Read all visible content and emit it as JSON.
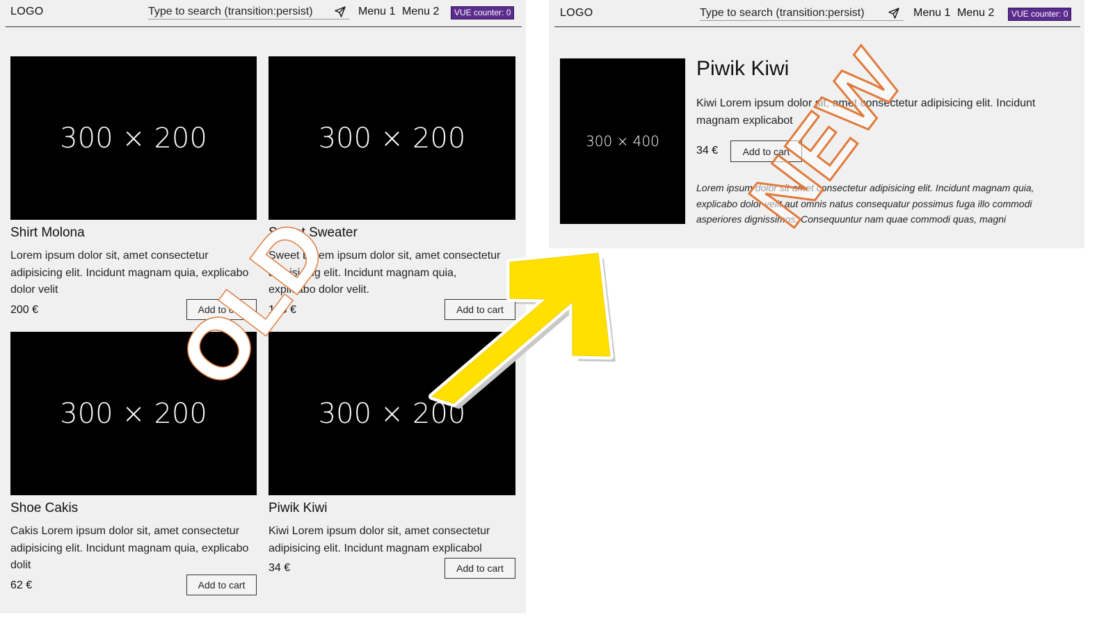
{
  "header": {
    "logo": "LOGO",
    "search_text": "Type to search (transition:persist)",
    "menu_1": "Menu 1",
    "menu_2": "Menu 2",
    "counter": "VUE counter: 0"
  },
  "old_page": {
    "products": [
      {
        "image_label": "300 × 200",
        "name": "Shirt Molona",
        "description": "Lorem ipsum dolor sit, amet consectetur adipisicing elit. Incidunt magnam quia, explicabo dolor velit",
        "price": "200 €",
        "button": "Add to cart"
      },
      {
        "image_label": "300 × 200",
        "name": "Sweet Sweater",
        "description": "Sweet Lorem ipsum dolor sit, amet consectetur adipisicing elit. Incidunt magnam quia, explicabo dolor velit.",
        "price": "150 €",
        "button": "Add to cart"
      },
      {
        "image_label": "300 × 200",
        "name": "Shoe Cakis",
        "description": "Cakis Lorem ipsum dolor sit, amet consectetur adipisicing elit. Incidunt magnam quia, explicabo dolit",
        "price": "62 €",
        "button": "Add to cart"
      },
      {
        "image_label": "300 × 200",
        "name": "Piwik Kiwi",
        "description": "Kiwi Lorem ipsum dolor sit, amet consectetur adipisicing elit. Incidunt magnam explicabol",
        "price": "34 €",
        "button": "Add to cart"
      }
    ]
  },
  "new_page": {
    "image_label": "300 × 400",
    "title": "Piwik Kiwi",
    "description": "Kiwi Lorem ipsum dolor sit, amet consectetur adipisicing elit. Incidunt magnam explicabot",
    "price": "34 €",
    "button": "Add to cart",
    "long_description": "Lorem ipsum dolor sit amet consectetur adipisicing elit. Incidunt magnam quia, explicabo dolor velit aut omnis natus consequatur possimus fuga illo commodi asperiores dignissimos. Consequuntur nam quae commodi quas, magni"
  },
  "annotations": {
    "old_label": "OLD",
    "new_label": "NEW",
    "colors": {
      "stamp_outline": "#e07a3c",
      "arrow_fill": "#ffe000",
      "badge": "#5b2b8d"
    }
  }
}
